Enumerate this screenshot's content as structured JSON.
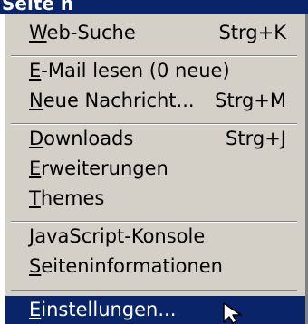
{
  "menubar": {
    "label": "Seite n"
  },
  "menu": {
    "items": [
      {
        "label": "Web-Suche",
        "shortcut": "Strg+K"
      },
      {
        "label": "E-Mail lesen (0 neue)",
        "shortcut": ""
      },
      {
        "label": "Neue Nachricht...",
        "shortcut": "Strg+M"
      },
      {
        "label": "Downloads",
        "shortcut": "Strg+J"
      },
      {
        "label": "Erweiterungen",
        "shortcut": ""
      },
      {
        "label": "Themes",
        "shortcut": ""
      },
      {
        "label": "JavaScript-Konsole",
        "shortcut": ""
      },
      {
        "label": "Seiteninformationen",
        "shortcut": ""
      },
      {
        "label": "Einstellungen...",
        "shortcut": ""
      }
    ],
    "selected_index": 8
  },
  "colors": {
    "menu_background": "#d4d0c8",
    "highlight": "#0a246a",
    "highlight_text": "#ffffff",
    "text": "#000000"
  },
  "icons": {
    "cursor": "arrow-cursor-icon"
  }
}
